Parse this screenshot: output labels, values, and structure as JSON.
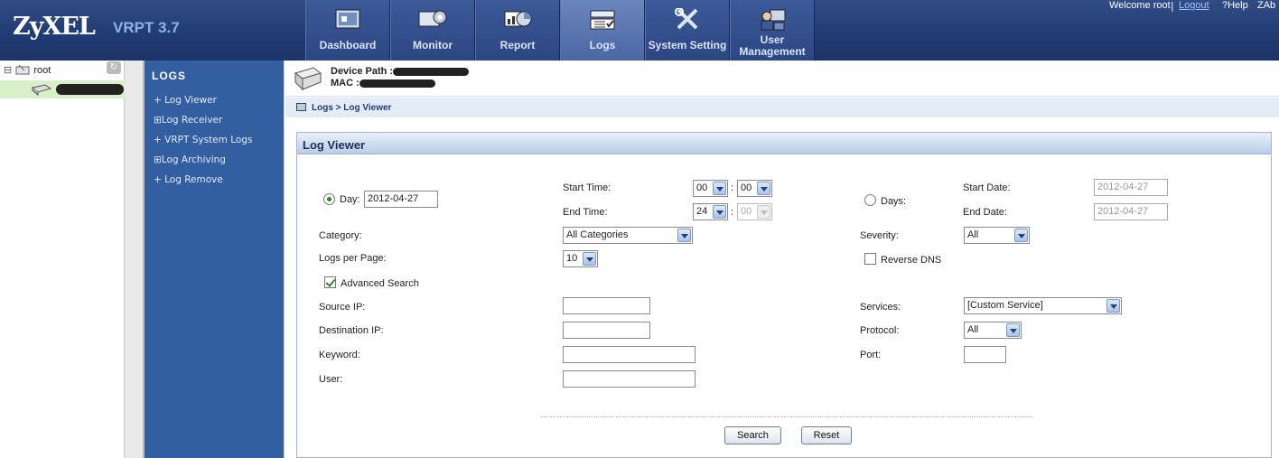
{
  "header": {
    "logo": "ZyXEL",
    "version": "VRPT 3.7",
    "tabs": [
      {
        "label": "Dashboard",
        "icon": "dashboard-icon"
      },
      {
        "label": "Monitor",
        "icon": "monitor-icon"
      },
      {
        "label": "Report",
        "icon": "report-icon"
      },
      {
        "label": "Logs",
        "icon": "logs-icon",
        "active": true
      },
      {
        "label": "System Setting",
        "icon": "tools-icon"
      },
      {
        "label": "User Management",
        "icon": "users-icon"
      }
    ],
    "welcome": "Welcome root",
    "separator": "|",
    "logout": "Logout",
    "help": "?Help",
    "about": "ZAb"
  },
  "tree": {
    "root_label": "root",
    "expand_symbol": "⊟"
  },
  "sidebar": {
    "title": "LOGS",
    "items": [
      {
        "label": "+ Log Viewer"
      },
      {
        "label": "⊞Log Receiver"
      },
      {
        "label": "+ VRPT System Logs"
      },
      {
        "label": "⊞Log Archiving"
      },
      {
        "label": "+ Log Remove"
      }
    ]
  },
  "device": {
    "path_label": "Device Path :",
    "mac_label": "MAC :"
  },
  "breadcrumb": "Logs > Log Viewer",
  "panel": {
    "title": "Log Viewer",
    "day_label": "Day:",
    "day_value": "2012-04-27",
    "start_time_label": "Start Time:",
    "start_hour": "00",
    "start_min": "00",
    "end_time_label": "End Time:",
    "end_hour": "24",
    "end_min": "00",
    "colon": ":",
    "days_label": "Days:",
    "start_date_label": "Start Date:",
    "start_date_value": "2012-04-27",
    "end_date_label": "End Date:",
    "end_date_value": "2012-04-27",
    "category_label": "Category:",
    "category_value": "All Categories",
    "severity_label": "Severity:",
    "severity_value": "All",
    "logs_per_page_label": "Logs per Page:",
    "logs_per_page_value": "10",
    "reverse_dns_label": "Reverse DNS",
    "advanced_search_label": "Advanced Search",
    "source_ip_label": "Source IP:",
    "destination_ip_label": "Destination IP:",
    "keyword_label": "Keyword:",
    "user_label": "User:",
    "services_label": "Services:",
    "services_value": "[Custom Service]",
    "protocol_label": "Protocol:",
    "protocol_value": "All",
    "port_label": "Port:",
    "search_button": "Search",
    "reset_button": "Reset"
  }
}
